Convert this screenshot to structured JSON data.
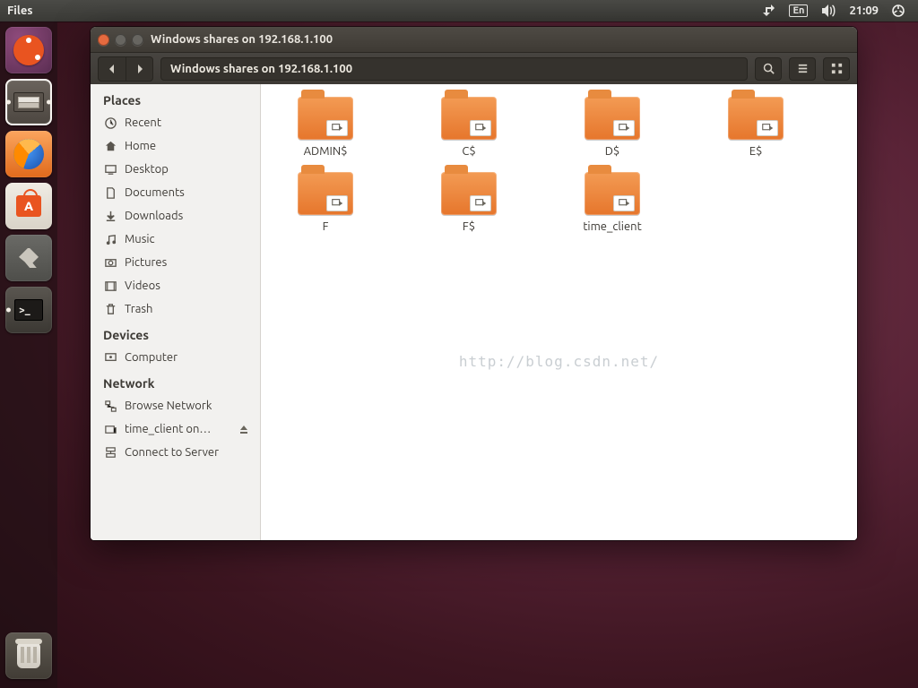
{
  "menubar": {
    "app_label": "Files",
    "lang": "En",
    "clock": "21:09"
  },
  "window": {
    "title": "Windows shares on 192.168.1.100",
    "path": "Windows shares on 192.168.1.100"
  },
  "sidebar": {
    "places_head": "Places",
    "devices_head": "Devices",
    "network_head": "Network",
    "places": [
      {
        "label": "Recent"
      },
      {
        "label": "Home"
      },
      {
        "label": "Desktop"
      },
      {
        "label": "Documents"
      },
      {
        "label": "Downloads"
      },
      {
        "label": "Music"
      },
      {
        "label": "Pictures"
      },
      {
        "label": "Videos"
      },
      {
        "label": "Trash"
      }
    ],
    "devices": [
      {
        "label": "Computer"
      }
    ],
    "network": [
      {
        "label": "Browse Network"
      },
      {
        "label": "time_client on…"
      },
      {
        "label": "Connect to Server"
      }
    ]
  },
  "folders": [
    {
      "label": "ADMIN$"
    },
    {
      "label": "C$"
    },
    {
      "label": "D$"
    },
    {
      "label": "E$"
    },
    {
      "label": "F"
    },
    {
      "label": "F$"
    },
    {
      "label": "time_client"
    }
  ],
  "watermark": "http://blog.csdn.net/"
}
